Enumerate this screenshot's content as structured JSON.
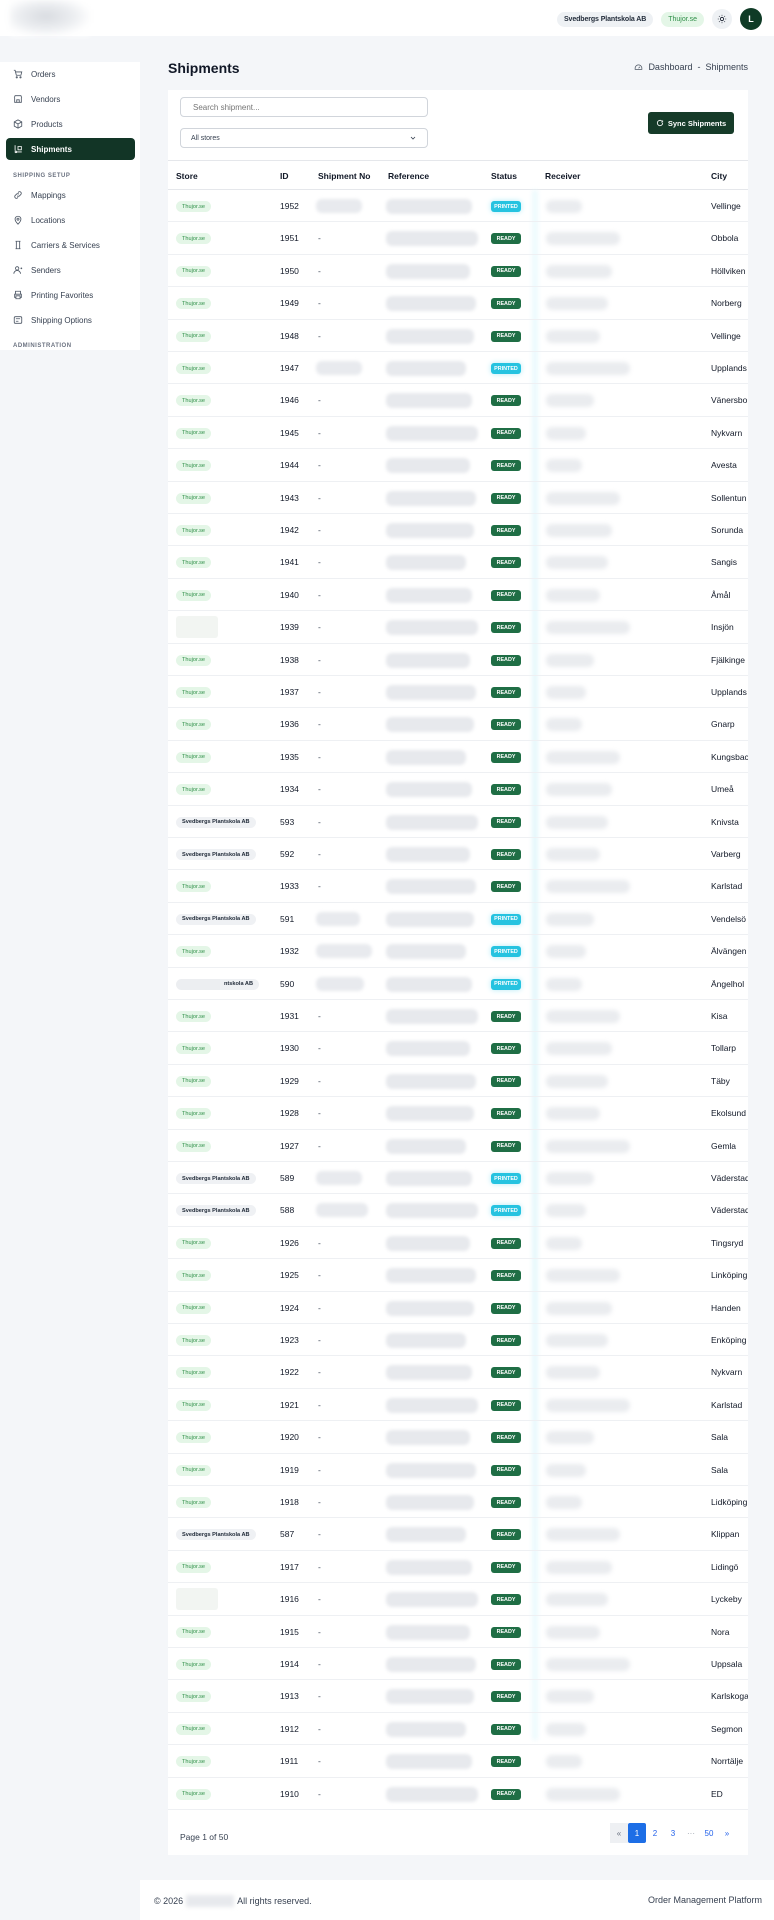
{
  "header": {
    "company": "Svedbergs Plantskola AB",
    "store": "Thujor.se",
    "avatar": "L"
  },
  "sidebar": {
    "items": [
      {
        "label": "Orders",
        "icon": "cart-icon"
      },
      {
        "label": "Vendors",
        "icon": "store-icon"
      },
      {
        "label": "Products",
        "icon": "box-icon"
      },
      {
        "label": "Shipments",
        "icon": "truck-icon",
        "active": true
      },
      {
        "label": "Mappings",
        "icon": "link-icon"
      },
      {
        "label": "Locations",
        "icon": "pin-icon"
      },
      {
        "label": "Carriers & Services",
        "icon": "carrier-icon"
      },
      {
        "label": "Senders",
        "icon": "user-icon"
      },
      {
        "label": "Printing Favorites",
        "icon": "printer-icon"
      },
      {
        "label": "Shipping Options",
        "icon": "options-icon"
      }
    ],
    "section_shipping": "SHIPPING SETUP",
    "section_admin": "ADMINISTRATION"
  },
  "page": {
    "title": "Shipments",
    "breadcrumb": [
      "Dashboard",
      "Shipments"
    ],
    "breadcrumb_sep": "-"
  },
  "toolbar": {
    "search_placeholder": "Search shipment...",
    "store_filter": "All stores",
    "sync_label": "Sync Shipments"
  },
  "table": {
    "columns": [
      "Store",
      "ID",
      "Shipment No",
      "Reference",
      "Status",
      "Receiver",
      "City"
    ],
    "rows": [
      {
        "store": "Thujor.se",
        "id": "1952",
        "shipment": "",
        "status": "PRINTED",
        "city": "Vellinge"
      },
      {
        "store": "Thujor.se",
        "id": "1951",
        "shipment": "-",
        "status": "READY",
        "city": "Obbola"
      },
      {
        "store": "Thujor.se",
        "id": "1950",
        "shipment": "-",
        "status": "READY",
        "city": "Höllviken"
      },
      {
        "store": "Thujor.se",
        "id": "1949",
        "shipment": "-",
        "status": "READY",
        "city": "Norberg"
      },
      {
        "store": "Thujor.se",
        "id": "1948",
        "shipment": "-",
        "status": "READY",
        "city": "Vellinge"
      },
      {
        "store": "Thujor.se",
        "id": "1947",
        "shipment": "",
        "status": "PRINTED",
        "city": "Upplands"
      },
      {
        "store": "Thujor.se",
        "id": "1946",
        "shipment": "-",
        "status": "READY",
        "city": "Vänersbo"
      },
      {
        "store": "Thujor.se",
        "id": "1945",
        "shipment": "-",
        "status": "READY",
        "city": "Nykvarn"
      },
      {
        "store": "Thujor.se",
        "id": "1944",
        "shipment": "-",
        "status": "READY",
        "city": "Avesta"
      },
      {
        "store": "Thujor.se",
        "id": "1943",
        "shipment": "-",
        "status": "READY",
        "city": "Sollentun"
      },
      {
        "store": "Thujor.se",
        "id": "1942",
        "shipment": "-",
        "status": "READY",
        "city": "Sorunda"
      },
      {
        "store": "Thujor.se",
        "id": "1941",
        "shipment": "-",
        "status": "READY",
        "city": "Sangis"
      },
      {
        "store": "Thujor.se",
        "id": "1940",
        "shipment": "-",
        "status": "READY",
        "city": "Åmål"
      },
      {
        "store": "",
        "id": "1939",
        "shipment": "-",
        "status": "READY",
        "city": "Insjön"
      },
      {
        "store": "Thujor.se",
        "id": "1938",
        "shipment": "-",
        "status": "READY",
        "city": "Fjälkinge"
      },
      {
        "store": "Thujor.se",
        "id": "1937",
        "shipment": "-",
        "status": "READY",
        "city": "Upplands"
      },
      {
        "store": "Thujor.se",
        "id": "1936",
        "shipment": "-",
        "status": "READY",
        "city": "Gnarp"
      },
      {
        "store": "Thujor.se",
        "id": "1935",
        "shipment": "-",
        "status": "READY",
        "city": "Kungsbac"
      },
      {
        "store": "Thujor.se",
        "id": "1934",
        "shipment": "-",
        "status": "READY",
        "city": "Umeå"
      },
      {
        "store": "Svedbergs Plantskola AB",
        "id": "593",
        "shipment": "-",
        "status": "READY",
        "city": "Knivsta"
      },
      {
        "store": "Svedbergs Plantskola AB",
        "id": "592",
        "shipment": "-",
        "status": "READY",
        "city": "Varberg"
      },
      {
        "store": "Thujor.se",
        "id": "1933",
        "shipment": "-",
        "status": "READY",
        "city": "Karlstad"
      },
      {
        "store": "Svedbergs Plantskola AB",
        "id": "591",
        "shipment": "",
        "status": "PRINTED",
        "city": "Vendelsö"
      },
      {
        "store": "Thujor.se",
        "id": "1932",
        "shipment": "",
        "status": "PRINTED",
        "city": "Älvängen"
      },
      {
        "store": "ntskola AB",
        "id": "590",
        "shipment": "",
        "status": "PRINTED",
        "city": "Ängelhol"
      },
      {
        "store": "Thujor.se",
        "id": "1931",
        "shipment": "-",
        "status": "READY",
        "city": "Kisa"
      },
      {
        "store": "Thujor.se",
        "id": "1930",
        "shipment": "-",
        "status": "READY",
        "city": "Tollarp"
      },
      {
        "store": "Thujor.se",
        "id": "1929",
        "shipment": "-",
        "status": "READY",
        "city": "Täby"
      },
      {
        "store": "Thujor.se",
        "id": "1928",
        "shipment": "-",
        "status": "READY",
        "city": "Ekolsund"
      },
      {
        "store": "Thujor.se",
        "id": "1927",
        "shipment": "-",
        "status": "READY",
        "city": "Gemla"
      },
      {
        "store": "Svedbergs Plantskola AB",
        "id": "589",
        "shipment": "",
        "status": "PRINTED",
        "city": "Väderstad"
      },
      {
        "store": "Svedbergs Plantskola AB",
        "id": "588",
        "shipment": "",
        "status": "PRINTED",
        "city": "Väderstad"
      },
      {
        "store": "Thujor.se",
        "id": "1926",
        "shipment": "-",
        "status": "READY",
        "city": "Tingsryd"
      },
      {
        "store": "Thujor.se",
        "id": "1925",
        "shipment": "-",
        "status": "READY",
        "city": "Linköping"
      },
      {
        "store": "Thujor.se",
        "id": "1924",
        "shipment": "-",
        "status": "READY",
        "city": "Handen"
      },
      {
        "store": "Thujor.se",
        "id": "1923",
        "shipment": "-",
        "status": "READY",
        "city": "Enköping"
      },
      {
        "store": "Thujor.se",
        "id": "1922",
        "shipment": "-",
        "status": "READY",
        "city": "Nykvarn"
      },
      {
        "store": "Thujor.se",
        "id": "1921",
        "shipment": "-",
        "status": "READY",
        "city": "Karlstad"
      },
      {
        "store": "Thujor.se",
        "id": "1920",
        "shipment": "-",
        "status": "READY",
        "city": "Sala"
      },
      {
        "store": "Thujor.se",
        "id": "1919",
        "shipment": "-",
        "status": "READY",
        "city": "Sala"
      },
      {
        "store": "Thujor.se",
        "id": "1918",
        "shipment": "-",
        "status": "READY",
        "city": "Lidköping"
      },
      {
        "store": "Svedbergs Plantskola AB",
        "id": "587",
        "shipment": "-",
        "status": "READY",
        "city": "Klippan"
      },
      {
        "store": "Thujor.se",
        "id": "1917",
        "shipment": "-",
        "status": "READY",
        "city": "Lidingö"
      },
      {
        "store": "",
        "id": "1916",
        "shipment": "-",
        "status": "READY",
        "city": "Lyckeby"
      },
      {
        "store": "Thujor.se",
        "id": "1915",
        "shipment": "-",
        "status": "READY",
        "city": "Nora"
      },
      {
        "store": "Thujor.se",
        "id": "1914",
        "shipment": "-",
        "status": "READY",
        "city": "Uppsala"
      },
      {
        "store": "Thujor.se",
        "id": "1913",
        "shipment": "-",
        "status": "READY",
        "city": "Karlskoga"
      },
      {
        "store": "Thujor.se",
        "id": "1912",
        "shipment": "-",
        "status": "READY",
        "city": "Segmon"
      },
      {
        "store": "Thujor.se",
        "id": "1911",
        "shipment": "-",
        "status": "READY",
        "city": "Norrtälje"
      },
      {
        "store": "Thujor.se",
        "id": "1910",
        "shipment": "-",
        "status": "READY",
        "city": "ED"
      }
    ]
  },
  "pagination": {
    "summary": "Page 1 of 50",
    "prev": "«",
    "pages": [
      "1",
      "2",
      "3"
    ],
    "ellipsis": "···",
    "last": "50",
    "next": "»",
    "current": "1"
  },
  "footer": {
    "copyright": "© 2026",
    "rights": "All rights reserved.",
    "product": "Order Management Platform"
  },
  "colors": {
    "accent_dark": "#123526",
    "ready": "#1f6e45",
    "printed": "#26c3e0",
    "store_green_bg": "#e4f6e7",
    "link": "#1d6ee6"
  }
}
